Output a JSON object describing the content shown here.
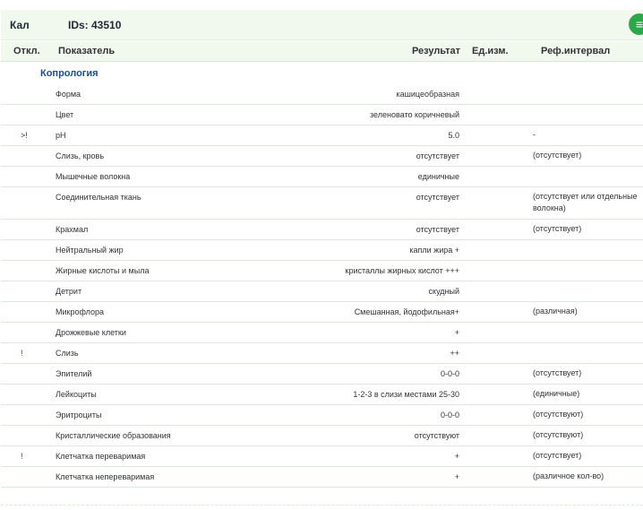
{
  "header": {
    "sample": "Кал",
    "ids": "IDs: 43510",
    "action_icon": "list-icon"
  },
  "columns": {
    "flag": "Откл.",
    "param": "Показатель",
    "result": "Результат",
    "unit": "Ед.изм.",
    "ref": "Реф.интервал"
  },
  "section": "Копрология",
  "rows": [
    {
      "flag": "",
      "param": "Форма",
      "result": "кашицеобразная",
      "unit": "",
      "ref": ""
    },
    {
      "flag": "",
      "param": "Цвет",
      "result": "зеленовато коричневый",
      "unit": "",
      "ref": ""
    },
    {
      "flag": ">!",
      "param": "pH",
      "result": "5.0",
      "unit": "",
      "ref": "-"
    },
    {
      "flag": "",
      "param": "Слизь, кровь",
      "result": "отсутствует",
      "unit": "",
      "ref": "(отсутствует)"
    },
    {
      "flag": "",
      "param": "Мышечные волокна",
      "result": "единичные",
      "unit": "",
      "ref": ""
    },
    {
      "flag": "",
      "param": "Соединительная ткань",
      "result": "отсутствует",
      "unit": "",
      "ref": "(отсутствует или отдельные волокна)"
    },
    {
      "flag": "",
      "param": "Крахмал",
      "result": "отсутствует",
      "unit": "",
      "ref": "(отсутствует)"
    },
    {
      "flag": "",
      "param": "Нейтральный жир",
      "result": "капли жира +",
      "unit": "",
      "ref": ""
    },
    {
      "flag": "",
      "param": "Жирные кислоты и мыла",
      "result": "кристаллы жирных кислот +++",
      "unit": "",
      "ref": ""
    },
    {
      "flag": "",
      "param": "Детрит",
      "result": "скудный",
      "unit": "",
      "ref": ""
    },
    {
      "flag": "",
      "param": "Микрофлора",
      "result": "Смешанная, йодофильная+",
      "unit": "",
      "ref": "(различная)"
    },
    {
      "flag": "",
      "param": "Дрожжевые клетки",
      "result": "+",
      "unit": "",
      "ref": ""
    },
    {
      "flag": "!",
      "param": "Слизь",
      "result": "++",
      "unit": "",
      "ref": ""
    },
    {
      "flag": "",
      "param": "Эпителий",
      "result": "0-0-0",
      "unit": "",
      "ref": "(отсутствует)"
    },
    {
      "flag": "",
      "param": "Лейкоциты",
      "result": "1-2-3 в слизи местами 25-30",
      "unit": "",
      "ref": "(единичные)"
    },
    {
      "flag": "",
      "param": "Эритроциты",
      "result": "0-0-0",
      "unit": "",
      "ref": "(отсутствуют)"
    },
    {
      "flag": "",
      "param": "Кристаллические образования",
      "result": "отсутствуют",
      "unit": "",
      "ref": "(отсутствуют)"
    },
    {
      "flag": "!",
      "param": "Клетчатка переваримая",
      "result": "+",
      "unit": "",
      "ref": "(отсутствует)"
    },
    {
      "flag": "",
      "param": "Клетчатка непереваримая",
      "result": "+",
      "unit": "",
      "ref": "(различное кол-во)"
    }
  ]
}
